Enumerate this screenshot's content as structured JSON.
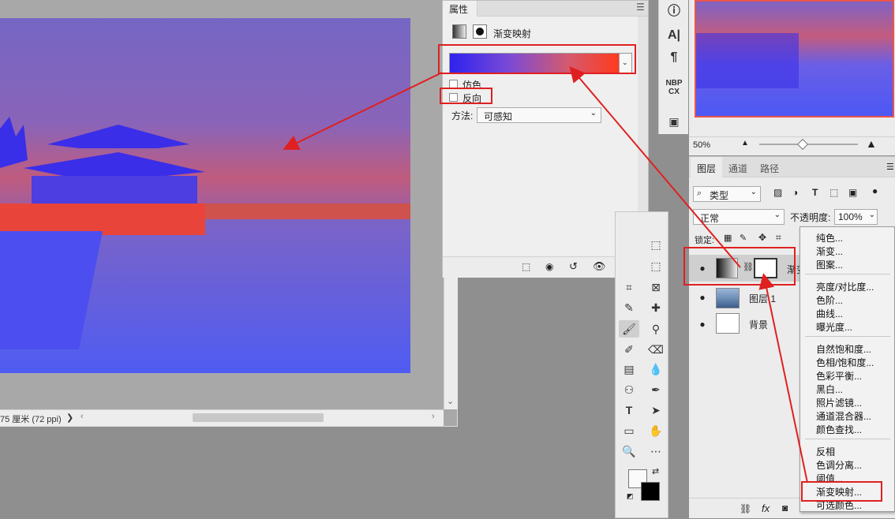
{
  "document": {
    "status_text": "75 厘米 (72 ppi)",
    "status_arrow": "❯",
    "scroll_left_arrow": "‹",
    "scroll_right_arrow": "›",
    "scroll_down_arrow": "⌄"
  },
  "properties": {
    "tab_label": "属性",
    "adjustment_title": "渐变映射",
    "dither_label": "仿色",
    "reverse_label": "反向",
    "method_label": "方法:",
    "method_value": "可感知",
    "gradient_colors": [
      "#2d22ee",
      "#ff3a1e"
    ]
  },
  "icon_strip": {
    "info": "ⓘ",
    "character": "A|",
    "paragraph": "¶",
    "glyphs": "NBP CX"
  },
  "navigator": {
    "zoom": "50%"
  },
  "layers": {
    "tabs": [
      "图层",
      "通道",
      "路径"
    ],
    "filter_kind": "类型",
    "blend_mode": "正常",
    "opacity_label": "不透明度:",
    "opacity_value": "100%",
    "lock_label": "锁定:",
    "rows": [
      {
        "name": "渐变",
        "type": "adjustment"
      },
      {
        "name": "图层 1",
        "type": "image"
      },
      {
        "name": "背景",
        "type": "background"
      }
    ],
    "footer_fx": "fx"
  },
  "context_menu": {
    "group1": [
      "纯色...",
      "渐变...",
      "图案..."
    ],
    "group2": [
      "亮度/对比度...",
      "色阶...",
      "曲线...",
      "曝光度..."
    ],
    "group3": [
      "自然饱和度...",
      "色相/饱和度...",
      "色彩平衡...",
      "黑白...",
      "照片滤镜...",
      "通道混合器...",
      "颜色查找..."
    ],
    "group4": [
      "反相",
      "色调分离...",
      "阈值...",
      "渐变映射...",
      "可选颜色..."
    ]
  },
  "colors": {
    "highlight": "#e02020",
    "panel_bg": "#ececec"
  }
}
